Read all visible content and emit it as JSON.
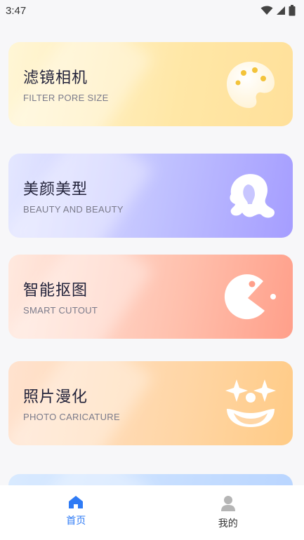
{
  "status": {
    "time": "3:47"
  },
  "cards": [
    {
      "title": "滤镜相机",
      "subtitle": "FILTER PORE SIZE",
      "icon": "palette-icon"
    },
    {
      "title": "美颜美型",
      "subtitle": "BEAUTY AND BEAUTY",
      "icon": "woman-head-icon"
    },
    {
      "title": "智能抠图",
      "subtitle": "SMART CUTOUT",
      "icon": "pacman-icon"
    },
    {
      "title": "照片漫化",
      "subtitle": "PHOTO CARICATURE",
      "icon": "clown-face-icon"
    }
  ],
  "tabbar": {
    "items": [
      {
        "label": "首页",
        "icon": "home-icon",
        "active": true
      },
      {
        "label": "我的",
        "icon": "user-icon",
        "active": false
      }
    ]
  },
  "colors": {
    "accent": "#2f7bf5",
    "card1": "#ffe7a6",
    "card2": "#bfc0ff",
    "card3": "#ffc0ad",
    "card4": "#ffd6a6",
    "card5": "#b9d5ff"
  }
}
